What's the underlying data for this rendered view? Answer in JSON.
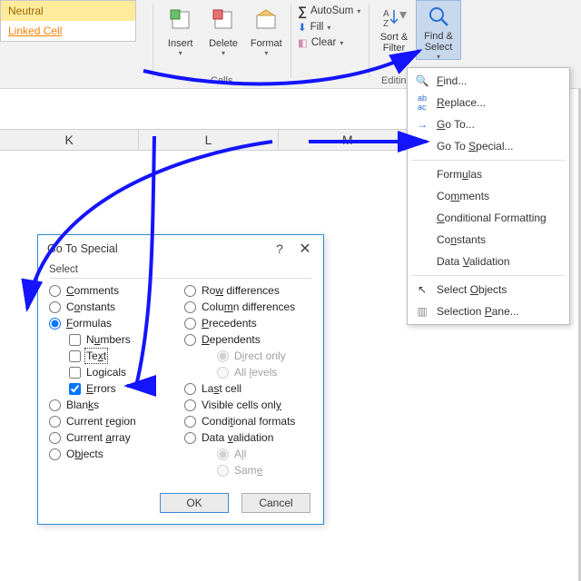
{
  "ribbon": {
    "styles": {
      "neutral": "Neutral",
      "linked": "Linked Cell"
    },
    "cells": {
      "insert": "Insert",
      "delete": "Delete",
      "format": "Format",
      "group": "Cells"
    },
    "editing": {
      "autosum": "AutoSum",
      "fill": "Fill",
      "clear": "Clear",
      "sort": "Sort &\nFilter",
      "find": "Find &\nSelect",
      "group": "Editing"
    }
  },
  "columns": [
    "K",
    "L",
    "M"
  ],
  "menu": {
    "find": "Find...",
    "replace": "Replace...",
    "goto": "Go To...",
    "gotospecial": "Go To Special...",
    "formulas": "Formulas",
    "comments": "Comments",
    "condfmt": "Conditional Formatting",
    "constants": "Constants",
    "dataval": "Data Validation",
    "selobj": "Select Objects",
    "selpane": "Selection Pane..."
  },
  "dlg": {
    "title": "Go To Special",
    "section": "Select",
    "left": {
      "comments": "Comments",
      "constants": "Constants",
      "formulas": "Formulas",
      "numbers": "Numbers",
      "text": "Text",
      "logicals": "Logicals",
      "errors": "Errors",
      "blanks": "Blanks",
      "curregion": "Current region",
      "curarray": "Current array",
      "objects": "Objects"
    },
    "right": {
      "rowdiff": "Row differences",
      "coldiff": "Column differences",
      "precedents": "Precedents",
      "dependents": "Dependents",
      "direct": "Direct only",
      "alllevels": "All levels",
      "last": "Last cell",
      "visible": "Visible cells only",
      "condfmt": "Conditional formats",
      "dataval": "Data validation",
      "all": "All",
      "same": "Same"
    },
    "ok": "OK",
    "cancel": "Cancel"
  }
}
